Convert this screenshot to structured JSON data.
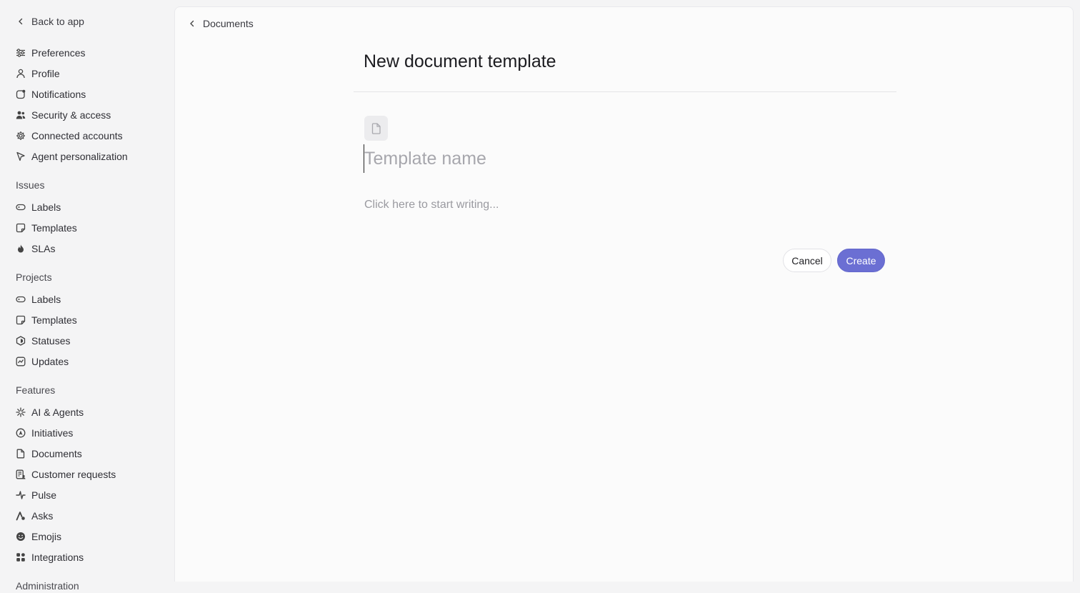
{
  "sidebar": {
    "back_label": "Back to app",
    "account_items": [
      {
        "label": "Preferences",
        "icon": "sliders-icon"
      },
      {
        "label": "Profile",
        "icon": "person-icon"
      },
      {
        "label": "Notifications",
        "icon": "notification-icon"
      },
      {
        "label": "Security & access",
        "icon": "users-icon"
      },
      {
        "label": "Connected accounts",
        "icon": "gear-icon"
      },
      {
        "label": "Agent personalization",
        "icon": "cursor-icon"
      }
    ],
    "issues": {
      "title": "Issues",
      "items": [
        {
          "label": "Labels",
          "icon": "tag-icon"
        },
        {
          "label": "Templates",
          "icon": "template-icon"
        },
        {
          "label": "SLAs",
          "icon": "flame-icon"
        }
      ]
    },
    "projects": {
      "title": "Projects",
      "items": [
        {
          "label": "Labels",
          "icon": "tag-icon"
        },
        {
          "label": "Templates",
          "icon": "template-icon"
        },
        {
          "label": "Statuses",
          "icon": "hexagon-icon"
        },
        {
          "label": "Updates",
          "icon": "chart-icon"
        }
      ]
    },
    "features": {
      "title": "Features",
      "items": [
        {
          "label": "AI & Agents",
          "icon": "sparkle-icon"
        },
        {
          "label": "Initiatives",
          "icon": "rocket-icon"
        },
        {
          "label": "Documents",
          "icon": "document-icon"
        },
        {
          "label": "Customer requests",
          "icon": "customer-icon"
        },
        {
          "label": "Pulse",
          "icon": "pulse-icon"
        },
        {
          "label": "Asks",
          "icon": "asks-icon"
        },
        {
          "label": "Emojis",
          "icon": "smiley-icon"
        },
        {
          "label": "Integrations",
          "icon": "grid-icon"
        }
      ]
    },
    "administration": {
      "title": "Administration"
    }
  },
  "main": {
    "breadcrumb": "Documents",
    "title": "New document template",
    "name_placeholder": "Template name",
    "body_placeholder": "Click here to start writing...",
    "cancel_label": "Cancel",
    "create_label": "Create",
    "accent_color": "#6b6fd3"
  }
}
